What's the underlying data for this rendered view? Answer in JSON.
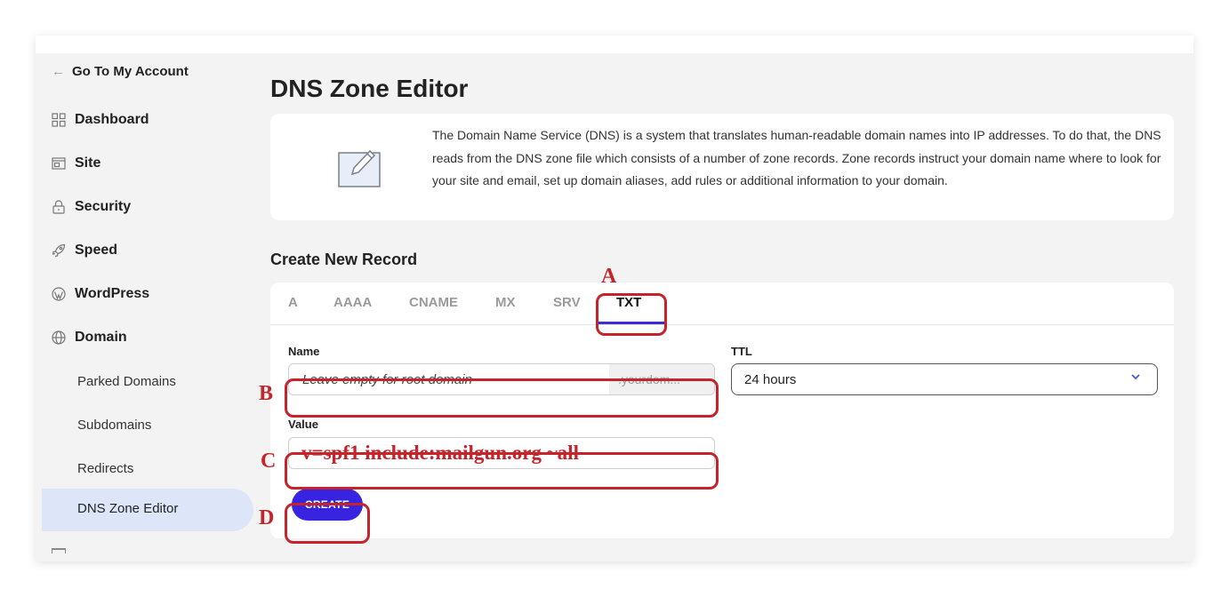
{
  "sidebar": {
    "back_label": "Go To My Account",
    "items": [
      {
        "label": "Dashboard",
        "icon": "grid-icon"
      },
      {
        "label": "Site",
        "icon": "site-icon"
      },
      {
        "label": "Security",
        "icon": "lock-icon"
      },
      {
        "label": "Speed",
        "icon": "rocket-icon"
      },
      {
        "label": "WordPress",
        "icon": "wordpress-icon"
      },
      {
        "label": "Domain",
        "icon": "globe-icon"
      }
    ],
    "sub_items": [
      {
        "label": "Parked Domains"
      },
      {
        "label": "Subdomains"
      },
      {
        "label": "Redirects"
      },
      {
        "label": "DNS Zone Editor",
        "active": true
      }
    ]
  },
  "main": {
    "title": "DNS Zone Editor",
    "info_text": "The Domain Name Service (DNS) is a system that translates human-readable domain names into IP addresses. To do that, the DNS reads from the DNS zone file which consists of a number of zone records. Zone records instruct your domain name where to look for your site and email, set up domain aliases, add rules or additional information to your domain.",
    "section_title": "Create New Record",
    "tabs": [
      "A",
      "AAAA",
      "CNAME",
      "MX",
      "SRV",
      "TXT"
    ],
    "active_tab": "TXT",
    "name_label": "Name",
    "name_placeholder": "Leave empty for root domain",
    "name_suffix": ".yourdom...",
    "ttl_label": "TTL",
    "ttl_value": "24 hours",
    "value_label": "Value",
    "value_text": "v=spf1 include:mailgun.org ~all",
    "create_label": "CREATE"
  },
  "annotations": [
    "A",
    "B",
    "C",
    "D"
  ],
  "colors": {
    "accent": "#3724e0",
    "annotation": "#c4242a",
    "active_nav_bg": "#dce6f8"
  }
}
